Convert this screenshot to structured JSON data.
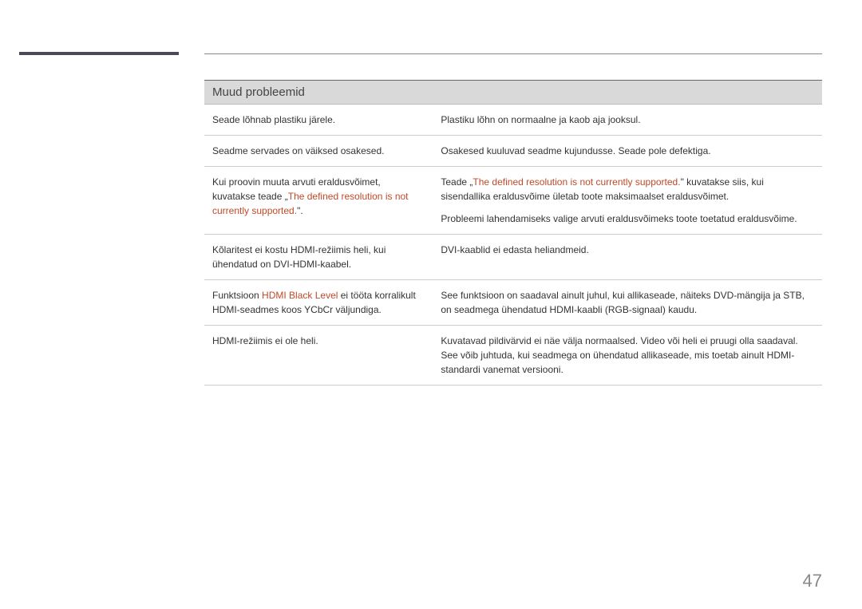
{
  "accent_color": "#4a4a5a",
  "highlight_color": "#c04a2a",
  "page_number": "47",
  "table": {
    "header": "Muud probleemid",
    "rows": [
      {
        "left": "Seade lõhnab plastiku järele.",
        "right": "Plastiku lõhn on normaalne ja kaob aja jooksul."
      },
      {
        "left": "Seadme servades on väiksed osakesed.",
        "right": "Osakesed kuuluvad seadme kujundusse. Seade pole defektiga."
      },
      {
        "left_pre": "Kui proovin muuta arvuti eraldusvõimet, kuvatakse teade „",
        "left_hl": "The defined resolution is not currently supported.",
        "left_post": "\".",
        "right_pre": "Teade „",
        "right_hl": "The defined resolution is not currently supported.",
        "right_post": "\" kuvatakse siis, kui sisendallika eraldusvõime ületab toote maksimaalset eraldusvõimet.",
        "right_p2": "Probleemi lahendamiseks valige arvuti eraldusvõimeks toote toetatud eraldusvõime."
      },
      {
        "left": "Kõlaritest ei kostu HDMI-režiimis heli, kui ühendatud on DVI-HDMI-kaabel.",
        "right": "DVI-kaablid ei edasta heliandmeid."
      },
      {
        "left_pre": "Funktsioon ",
        "left_hl": "HDMI Black Level",
        "left_post": " ei tööta korralikult HDMI-seadmes koos YCbCr väljundiga.",
        "right": "See funktsioon on saadaval ainult juhul, kui allikaseade, näiteks DVD-mängija ja STB, on seadmega ühendatud HDMI-kaabli (RGB-signaal) kaudu."
      },
      {
        "left": "HDMI-režiimis ei ole heli.",
        "right": "Kuvatavad pildivärvid ei näe välja normaalsed. Video või heli ei pruugi olla saadaval. See võib juhtuda, kui seadmega on ühendatud allikaseade, mis toetab ainult HDMI-standardi vanemat versiooni."
      }
    ]
  }
}
